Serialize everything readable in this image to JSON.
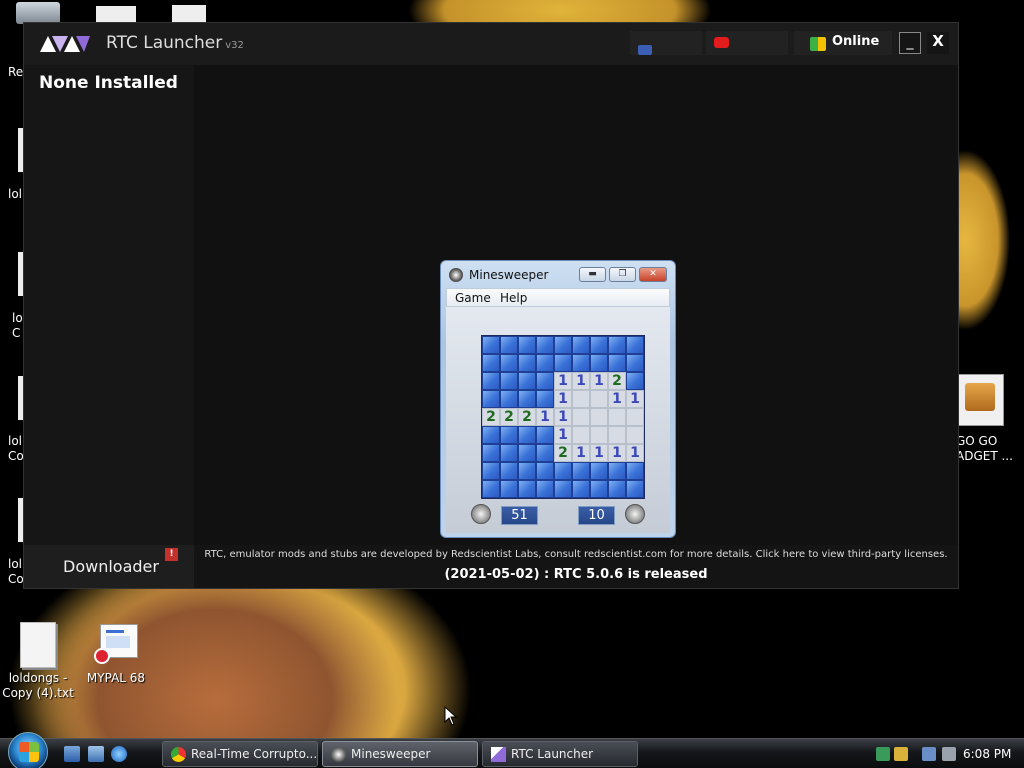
{
  "desktop": {
    "icons": [
      {
        "name": "loldongs-copy-4",
        "label": "loldongs - Copy (4).txt"
      },
      {
        "name": "mypal",
        "label": "MYPAL 68"
      }
    ],
    "partial_labels": [
      "Re",
      "lol",
      "lol\nC",
      "lol\nCo",
      "lol\nCo"
    ],
    "right_icon_label": "GO GO\nADGET ..."
  },
  "rtc": {
    "title": "RTC Launcher",
    "version": "v32",
    "status": "Online",
    "minimize_label": "_",
    "close_label": "X",
    "empty_state": "None Installed",
    "downloader_label": "Downloader",
    "downloader_badge": "!",
    "footer_note": "RTC, emulator mods and stubs are developed by Redscientist Labs, consult redscientist.com for more details. Click here to view third-party licenses.",
    "release_note": "(2021-05-02) : RTC 5.0.6 is released"
  },
  "minesweeper": {
    "title": "Minesweeper",
    "menu": [
      "Game",
      "Help"
    ],
    "timer": "51",
    "mines": "10",
    "grid": [
      [
        "",
        "",
        "",
        "",
        "",
        "",
        "",
        "",
        ""
      ],
      [
        "",
        "",
        "",
        "",
        "",
        "",
        "",
        "",
        ""
      ],
      [
        "",
        "",
        "",
        "",
        "1",
        "1",
        "1",
        "2",
        ""
      ],
      [
        "",
        "",
        "",
        "",
        "1",
        "",
        "",
        "1",
        "1"
      ],
      [
        "2",
        "2",
        "2",
        "1",
        "1",
        "",
        "",
        "",
        ""
      ],
      [
        "",
        "",
        "",
        "",
        "1",
        "",
        "",
        "",
        ""
      ],
      [
        "",
        "",
        "",
        "",
        "2",
        "1",
        "1",
        "1",
        "1"
      ],
      [
        "",
        "",
        "",
        "",
        "",
        "",
        "",
        "",
        ""
      ],
      [
        "",
        "",
        "",
        "",
        "",
        "",
        "",
        "",
        ""
      ]
    ],
    "opened": [
      [
        2,
        4
      ],
      [
        2,
        5
      ],
      [
        2,
        6
      ],
      [
        2,
        7
      ],
      [
        3,
        4
      ],
      [
        3,
        5
      ],
      [
        3,
        6
      ],
      [
        3,
        7
      ],
      [
        3,
        8
      ],
      [
        4,
        0
      ],
      [
        4,
        1
      ],
      [
        4,
        2
      ],
      [
        4,
        3
      ],
      [
        4,
        4
      ],
      [
        4,
        5
      ],
      [
        4,
        6
      ],
      [
        4,
        7
      ],
      [
        4,
        8
      ],
      [
        5,
        4
      ],
      [
        5,
        5
      ],
      [
        5,
        6
      ],
      [
        5,
        7
      ],
      [
        5,
        8
      ],
      [
        6,
        4
      ],
      [
        6,
        5
      ],
      [
        6,
        6
      ],
      [
        6,
        7
      ],
      [
        6,
        8
      ]
    ]
  },
  "taskbar": {
    "items": [
      {
        "label": "Real-Time Corrupto...",
        "icon": "chrome-icon"
      },
      {
        "label": "Minesweeper",
        "icon": "minesweeper-icon"
      },
      {
        "label": "RTC Launcher",
        "icon": "rtc-icon"
      }
    ],
    "clock": "6:08 PM"
  }
}
